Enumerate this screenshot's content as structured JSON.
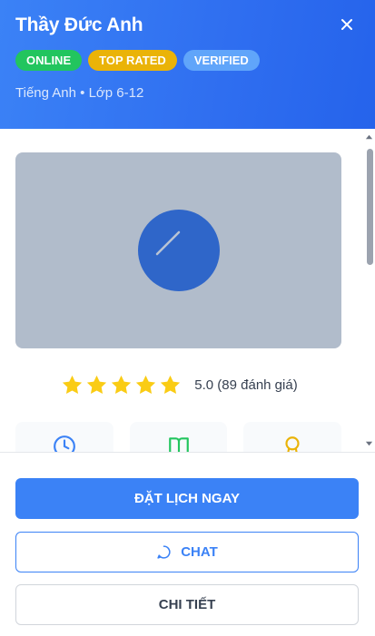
{
  "header": {
    "title": "Thầy Đức Anh",
    "badges": {
      "online": "ONLINE",
      "top_rated": "TOP RATED",
      "verified": "VERIFIED"
    },
    "subject": "Tiếng Anh • Lớp 6-12"
  },
  "rating": {
    "stars": 5,
    "text": "5.0 (89 đánh giá)"
  },
  "icons": {
    "close": "close-icon",
    "media": "play-icon",
    "card_1": "clock-icon",
    "card_2": "book-icon",
    "card_3": "award-icon",
    "chat": "chat-bubble-icon"
  },
  "actions": {
    "book": "ĐẶT LỊCH NGAY",
    "chat": "CHAT",
    "detail": "CHI TIẾT"
  },
  "colors": {
    "primary": "#3b82f6",
    "online": "#22c55e",
    "top_rated": "#eab308",
    "verified": "#60a5fa",
    "star": "#facc15"
  }
}
